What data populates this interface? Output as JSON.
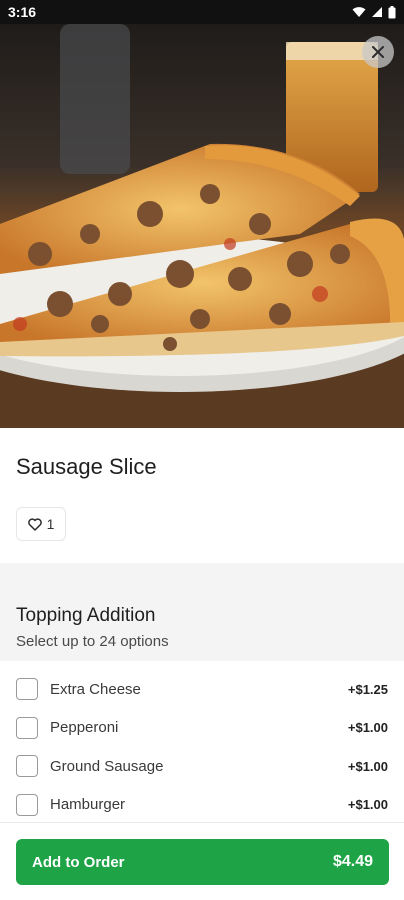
{
  "status_bar": {
    "time": "3:16"
  },
  "item": {
    "title": "Sausage Slice",
    "like_count": "1"
  },
  "section": {
    "title": "Topping Addition",
    "subtitle": "Select up to 24 options"
  },
  "options": [
    {
      "label": "Extra Cheese",
      "price": "+$1.25",
      "checked": false
    },
    {
      "label": "Pepperoni",
      "price": "+$1.00",
      "checked": false
    },
    {
      "label": "Ground Sausage",
      "price": "+$1.00",
      "checked": false
    },
    {
      "label": "Hamburger",
      "price": "+$1.00",
      "checked": false
    }
  ],
  "add_button": {
    "label": "Add to Order",
    "price": "$4.49"
  },
  "colors": {
    "accent": "#1ea446"
  },
  "icons": {
    "close": "close-icon",
    "like": "heart-icon"
  }
}
